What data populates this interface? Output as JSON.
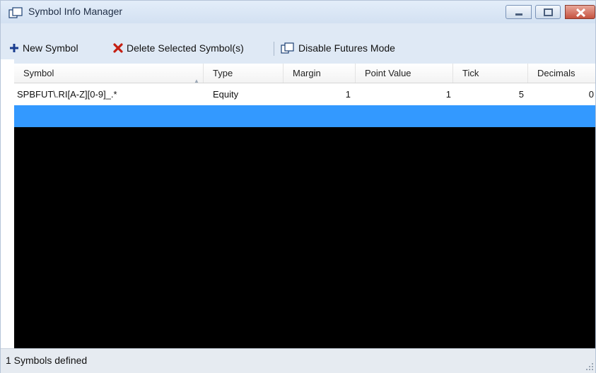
{
  "window": {
    "title": "Symbol Info Manager",
    "title_icon": "window-copy-icon"
  },
  "toolbar": {
    "new_symbol": "New Symbol",
    "delete_symbols": "Delete Selected Symbol(s)",
    "disable_futures": "Disable Futures Mode"
  },
  "grid": {
    "columns": [
      "Symbol",
      "Type",
      "Margin",
      "Point Value",
      "Tick",
      "Decimals"
    ],
    "sort_column": "Symbol",
    "rows": [
      {
        "symbol": "SPBFUT\\.RI[A-Z][0-9]_.*",
        "type": "Equity",
        "margin": "1",
        "point_value": "1",
        "tick": "5",
        "decimals": "0"
      }
    ]
  },
  "status": {
    "text": "1 Symbols defined"
  },
  "colors": {
    "selection": "#3399ff",
    "grid_background": "#000000",
    "chrome": "#dfe9f5"
  }
}
